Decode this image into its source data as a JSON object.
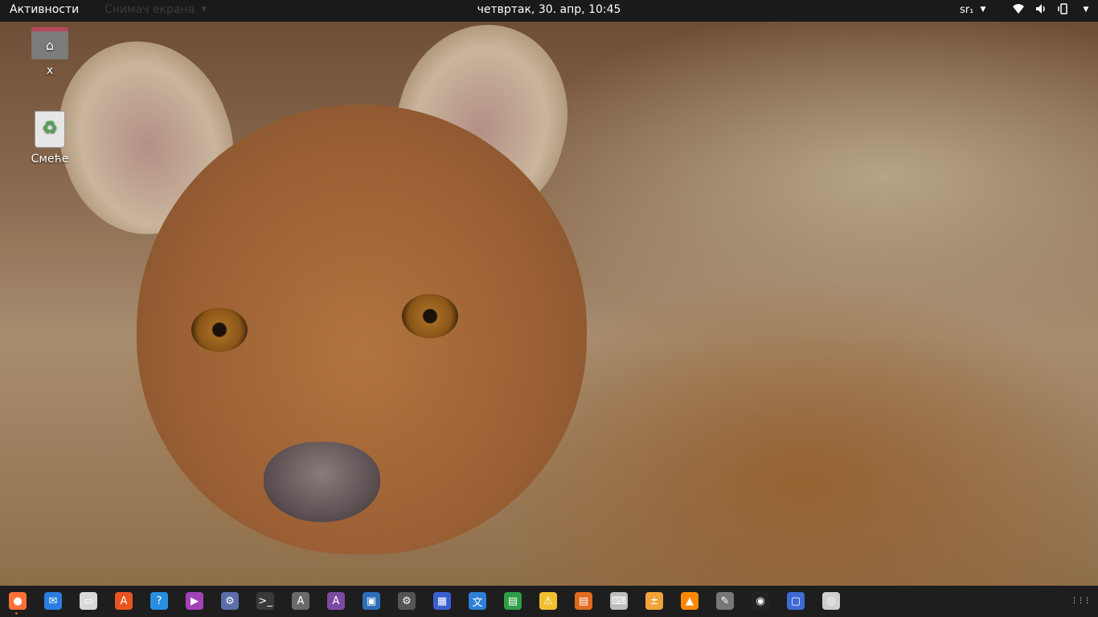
{
  "topbar": {
    "activities": "Активности",
    "app_menu": "Снимач екрана",
    "clock": "четвртак, 30. апр, 10:45",
    "language": "sr₁"
  },
  "desktop": {
    "home_label": "x",
    "trash_label": "Смеће"
  },
  "dock": {
    "items": [
      {
        "name": "firefox-icon",
        "glyph": "●",
        "color": "#ff7139"
      },
      {
        "name": "thunderbird-icon",
        "glyph": "✉",
        "color": "#2b7de0"
      },
      {
        "name": "files-icon",
        "glyph": "▭",
        "color": "#d9d9d9"
      },
      {
        "name": "software-center-icon",
        "glyph": "A",
        "color": "#e95420"
      },
      {
        "name": "help-icon",
        "glyph": "?",
        "color": "#2a8ee0"
      },
      {
        "name": "media-player-icon",
        "glyph": "▶",
        "color": "#a342b7"
      },
      {
        "name": "settings-tweaks-icon",
        "glyph": "⚙",
        "color": "#5a6fa8"
      },
      {
        "name": "terminal-icon",
        "glyph": ">_",
        "color": "#3a3a3a"
      },
      {
        "name": "app-store-icon",
        "glyph": "A",
        "color": "#6a6a6a"
      },
      {
        "name": "app-install-icon",
        "glyph": "A",
        "color": "#7e4aa0"
      },
      {
        "name": "image-viewer-icon",
        "glyph": "▣",
        "color": "#2c6fb7"
      },
      {
        "name": "system-settings-icon",
        "glyph": "⚙",
        "color": "#555"
      },
      {
        "name": "screenshot-icon",
        "glyph": "▦",
        "color": "#3b5fd1"
      },
      {
        "name": "translator-icon",
        "glyph": "文",
        "color": "#2f7fd6"
      },
      {
        "name": "spreadsheet-icon",
        "glyph": "▤",
        "color": "#2e9e48"
      },
      {
        "name": "document-viewer-icon",
        "glyph": "⚠",
        "color": "#f0c030"
      },
      {
        "name": "presentation-icon",
        "glyph": "▤",
        "color": "#e06a1e"
      },
      {
        "name": "keyboard-icon",
        "glyph": "⌨",
        "color": "#bdbdbd"
      },
      {
        "name": "calculator-icon",
        "glyph": "±",
        "color": "#f2a33a"
      },
      {
        "name": "vlc-icon",
        "glyph": "▲",
        "color": "#ff8800"
      },
      {
        "name": "tool-icon",
        "glyph": "✎",
        "color": "#777"
      },
      {
        "name": "obs-icon",
        "glyph": "◉",
        "color": "#222"
      },
      {
        "name": "remote-desktop-icon",
        "glyph": "▢",
        "color": "#3d6bd6"
      },
      {
        "name": "camera-icon",
        "glyph": "◎",
        "color": "#cfcfcf"
      }
    ],
    "grid_glyph": "⋮⋮⋮"
  }
}
